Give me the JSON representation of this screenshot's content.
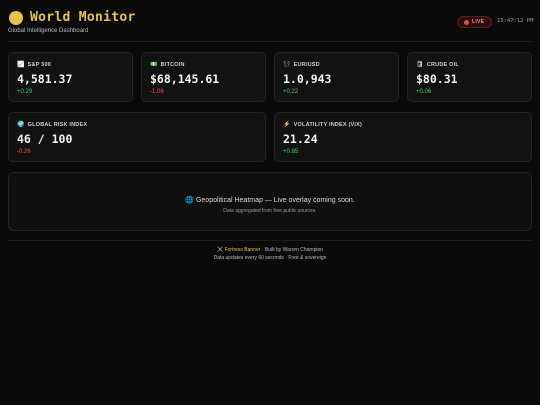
{
  "header": {
    "title": "World Monitor",
    "subtitle": "Global Intelligence Dashboard",
    "live_label": "LIVE",
    "clock": "15:47:12 PM"
  },
  "cards": [
    {
      "icon": "📈",
      "label": "S&P 500",
      "value": "4,581.37",
      "change": "+0.29"
    },
    {
      "icon": "💵",
      "label": "BITCOIN",
      "value": "$68,145.61",
      "change": "-1.06"
    },
    {
      "icon": "💱",
      "label": "EUR/USD",
      "value": "1.0,943",
      "change": "+0.22"
    },
    {
      "icon": "🛢",
      "label": "CRUDE OIL",
      "value": "$80.31",
      "change": "+0.06"
    },
    {
      "icon": "🌍",
      "label": "GLOBAL RISK INDEX",
      "value": "46 / 100",
      "change": "-0.26"
    },
    {
      "icon": "⚡",
      "label": "VOLATILITY INDEX (VIX)",
      "value": "21.24",
      "change": "+0.85"
    }
  ],
  "heatmap": {
    "title": "🌐 Geopolitical Heatmap — Live overlay coming soon.",
    "subtitle": "Data aggregated from free public sources."
  },
  "footer": {
    "icon": "⚔️",
    "brand": "Fortress Banner",
    "built_by": "· Built by Warren Champion",
    "line2": "Data updates every 60 seconds · Free & sovereign"
  },
  "colors": {
    "accent": "#e7c44a",
    "positive": "#3ecf6a",
    "negative": "#ef4b4b",
    "live": "#e5484d"
  }
}
